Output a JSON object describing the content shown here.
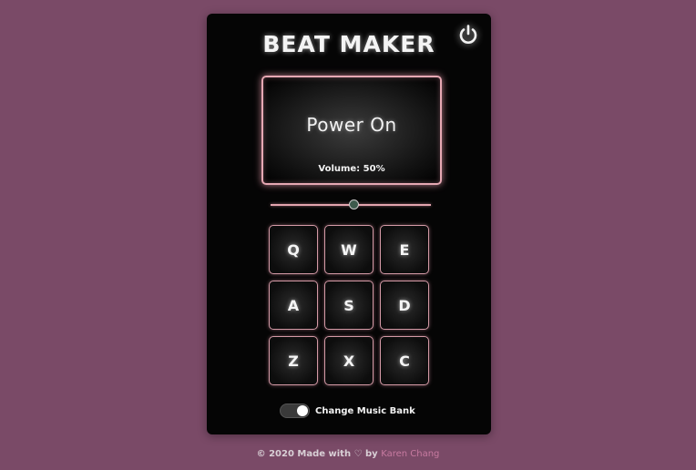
{
  "app": {
    "title": "BEAT MAKER"
  },
  "display": {
    "status": "Power On",
    "volume_text": "Volume: 50%"
  },
  "volume": {
    "value": 0.5
  },
  "pads": [
    {
      "key": "Q"
    },
    {
      "key": "W"
    },
    {
      "key": "E"
    },
    {
      "key": "A"
    },
    {
      "key": "S"
    },
    {
      "key": "D"
    },
    {
      "key": "Z"
    },
    {
      "key": "X"
    },
    {
      "key": "C"
    }
  ],
  "bank": {
    "label": "Change Music Bank",
    "toggled": true
  },
  "footer": {
    "prefix": "© 2020 Made with",
    "heart": "♡",
    "by": "by",
    "author": "Karen Chang"
  },
  "colors": {
    "background": "#7a4a67",
    "panel": "#050505",
    "accent_glow": "#e6a8b3",
    "author_link": "#c77aa0"
  },
  "icons": {
    "power": "power-icon"
  }
}
